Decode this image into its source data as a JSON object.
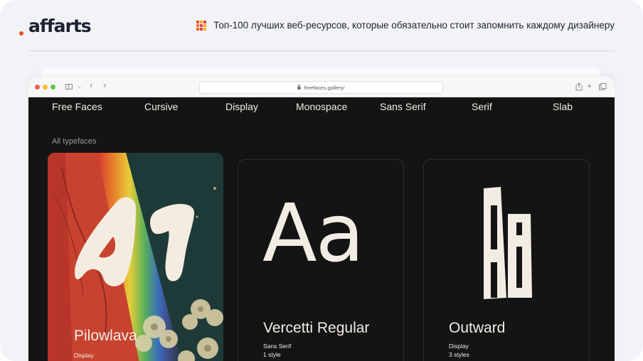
{
  "brand": {
    "logo_text": "affarts",
    "accent_color": "#f04e2a"
  },
  "header": {
    "headline": "Топ-100 лучших веб-ресурсов, которые обязательно стоит запомнить каждому дизайнеру",
    "grid_icon_colors": [
      "#f04e2a",
      "#f5a623",
      "#e8423a",
      "#f07a2a",
      "#e83a5a",
      "#f5a623",
      "#f05a2a",
      "#e8423a",
      "#f5b823"
    ]
  },
  "browser": {
    "url": "freefaces.gallery/",
    "traffic_lights": [
      "#ec5f57",
      "#f4be2e",
      "#5ec44a"
    ]
  },
  "site": {
    "nav": [
      "Free Faces",
      "Cursive",
      "Display",
      "Monospace",
      "Sans Serif",
      "Serif",
      "Slab"
    ],
    "section_label": "All typefaces",
    "cards": [
      {
        "name": "Pilowlava",
        "category": "Display",
        "glyph": "A1"
      },
      {
        "name": "Vercetti Regular",
        "category": "Sans Serif",
        "styles": "1 style",
        "glyph": "Aa"
      },
      {
        "name": "Outward",
        "category": "Display",
        "styles": "3 styles",
        "glyph": "Aa"
      }
    ]
  }
}
